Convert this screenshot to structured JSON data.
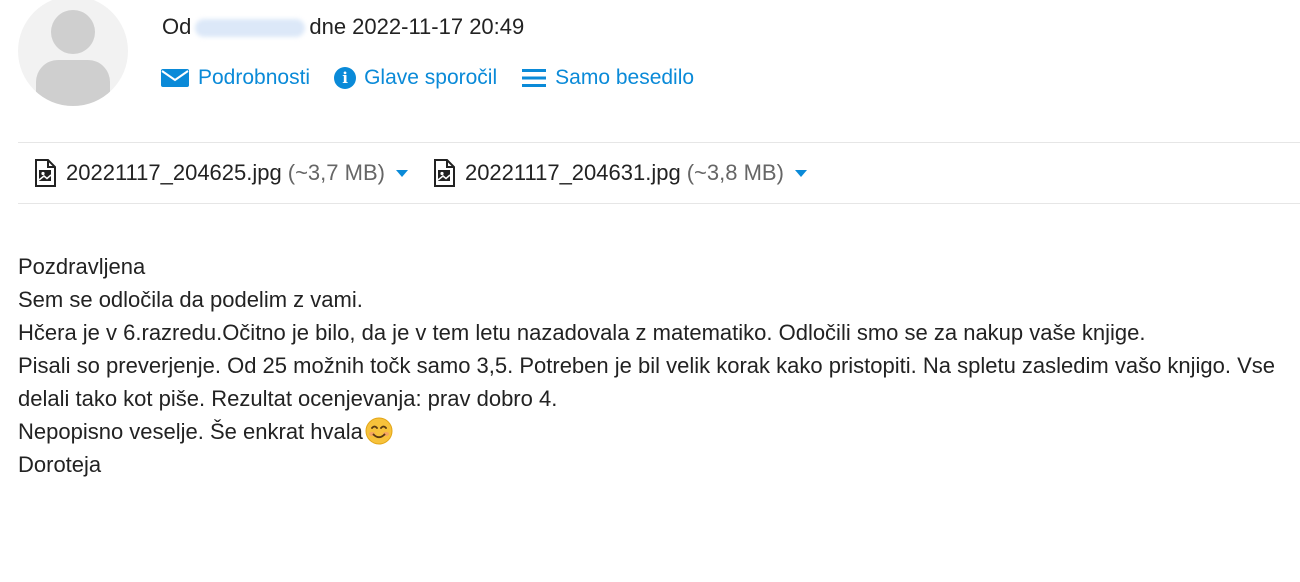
{
  "header": {
    "from_prefix": "Od",
    "date_text": "dne 2022-11-17 20:49",
    "actions": [
      {
        "label": "Podrobnosti",
        "icon": "envelope-icon"
      },
      {
        "label": "Glave sporočil",
        "icon": "info-icon"
      },
      {
        "label": "Samo besedilo",
        "icon": "lines-icon"
      }
    ]
  },
  "attachments": [
    {
      "name": "20221117_204625.jpg",
      "size": "(~3,7 MB)",
      "icon": "image-file-icon"
    },
    {
      "name": "20221117_204631.jpg",
      "size": "(~3,8 MB)",
      "icon": "image-file-icon"
    }
  ],
  "message": {
    "lines": [
      "Pozdravljena",
      "Sem se odločila da podelim z vami.",
      "Hčera je v 6.razredu.Očitno je bilo, da je v tem letu nazadovala z matematiko. Odločili smo se za nakup vaše knjige.",
      "Pisali so preverjenje. Od 25 možnih točk samo 3,5. Potreben je bil velik korak kako pristopiti. Na spletu zasledim vašo knjigo. Vse delali tako kot piše. Rezultat ocenjevanja: prav dobro 4.",
      "Nepopisno veselje. Še enkrat hvala",
      "Doroteja"
    ]
  },
  "colors": {
    "link": "#0a8ad8",
    "text": "#222222",
    "muted": "#666666",
    "divider": "#e6e6e6"
  }
}
